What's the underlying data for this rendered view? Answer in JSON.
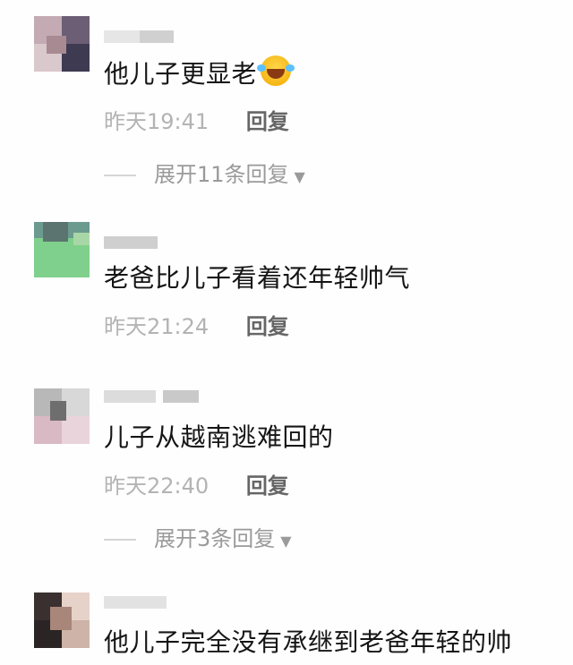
{
  "comments": [
    {
      "text": "他儿子更显老",
      "emoji": "laughing-crying-emoji",
      "time": "昨天19:41",
      "reply_label": "回复",
      "expand_label": "展开11条回复"
    },
    {
      "text": "老爸比儿子看着还年轻帅气",
      "time": "昨天21:24",
      "reply_label": "回复"
    },
    {
      "text": "儿子从越南逃难回的",
      "time": "昨天22:40",
      "reply_label": "回复",
      "expand_label": "展开3条回复"
    },
    {
      "text": "他儿子完全没有承继到老爸年轻的帅"
    }
  ],
  "colors": {
    "text": "#151515",
    "timestamp": "#b3b3b3",
    "reply": "#666666",
    "expand": "#9a9a9a"
  }
}
